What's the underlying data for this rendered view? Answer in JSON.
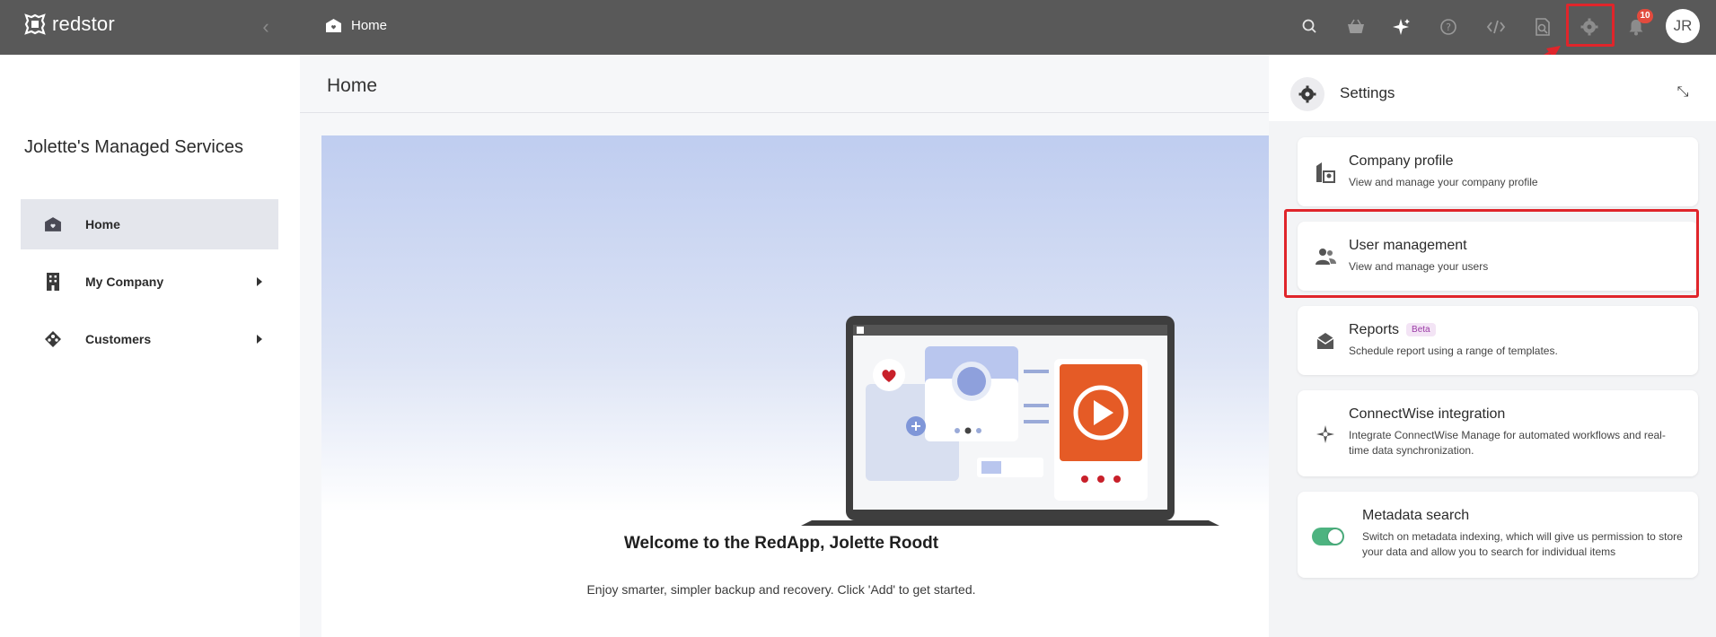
{
  "app": {
    "logo_text": "redstor"
  },
  "breadcrumb": {
    "label": "Home"
  },
  "topbar": {
    "notification_count": "10",
    "avatar_initials": "JR",
    "icons": [
      "search-icon",
      "basket-icon",
      "sparkle-icon",
      "help-icon",
      "code-icon",
      "search-document-icon",
      "gear-icon",
      "bell-icon"
    ]
  },
  "sidebar": {
    "org_name": "Jolette's Managed Services",
    "items": [
      {
        "label": "Home",
        "icon": "home-icon",
        "active": true
      },
      {
        "label": "My Company",
        "icon": "building-icon",
        "expandable": true
      },
      {
        "label": "Customers",
        "icon": "customers-icon",
        "expandable": true
      }
    ]
  },
  "main": {
    "title": "Home",
    "welcome_title": "Welcome to the RedApp, Jolette Roodt",
    "welcome_subtitle": "Enjoy smarter, simpler backup and recovery. Click 'Add' to get started."
  },
  "settings": {
    "title": "Settings",
    "cards": [
      {
        "title": "Company profile",
        "desc": "View and manage your company profile",
        "icon": "company-profile-icon"
      },
      {
        "title": "User management",
        "desc": "View and manage your users",
        "icon": "users-icon"
      },
      {
        "title": "Reports",
        "badge": "Beta",
        "desc": "Schedule report using a range of templates.",
        "icon": "mail-icon"
      },
      {
        "title": "ConnectWise integration",
        "desc": "Integrate ConnectWise Manage for automated workflows and real-time data synchronization.",
        "icon": "connectwise-icon"
      },
      {
        "title": "Metadata search",
        "desc": "Switch on metadata indexing, which will give us permission to store your data and allow you to search for individual items",
        "toggle_on": true
      }
    ]
  },
  "colors": {
    "topbar": "#595959",
    "highlight": "#e0252b",
    "toggle_on": "#4db380",
    "badge": "#e24b3e"
  }
}
